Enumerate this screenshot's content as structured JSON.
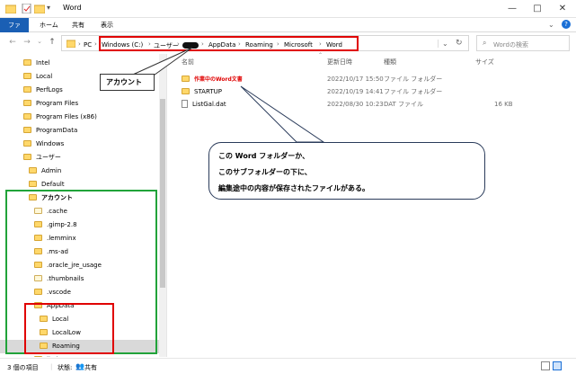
{
  "window": {
    "title": "Word",
    "minimize": "—",
    "maximize": "□",
    "close": "✕"
  },
  "ribbon": {
    "tabs": [
      "ファイル",
      "ホーム",
      "共有",
      "表示"
    ]
  },
  "address": {
    "crumbs": [
      "PC",
      "Windows (C:)",
      "ユーザー",
      "AppData",
      "Roaming",
      "Microsoft",
      "Word"
    ],
    "search_placeholder": "Wordの検索"
  },
  "nav_tree": [
    {
      "label": "Intel",
      "indent": 0
    },
    {
      "label": "Local",
      "indent": 0
    },
    {
      "label": "PerfLogs",
      "indent": 0
    },
    {
      "label": "Program Files",
      "indent": 0
    },
    {
      "label": "Program Files (x86)",
      "indent": 0
    },
    {
      "label": "ProgramData",
      "indent": 0
    },
    {
      "label": "Windows",
      "indent": 0
    },
    {
      "label": "ユーザー",
      "indent": 0
    },
    {
      "label": "Admin",
      "indent": 1
    },
    {
      "label": "Default",
      "indent": 1
    },
    {
      "label": "アカウント",
      "indent": 1
    },
    {
      "label": ".cache",
      "indent": 2
    },
    {
      "label": ".gimp-2.8",
      "indent": 2
    },
    {
      "label": ".lemminx",
      "indent": 2
    },
    {
      "label": ".ms-ad",
      "indent": 2
    },
    {
      "label": ".oracle_jre_usage",
      "indent": 2
    },
    {
      "label": ".thumbnails",
      "indent": 2
    },
    {
      "label": ".vscode",
      "indent": 2
    },
    {
      "label": "AppData",
      "indent": 2
    },
    {
      "label": "Local",
      "indent": 3
    },
    {
      "label": "LocalLow",
      "indent": 3
    },
    {
      "label": "Roaming",
      "indent": 3
    },
    {
      "label": "ibvi",
      "indent": 2
    }
  ],
  "file_list": {
    "headers": {
      "name": "名前",
      "date": "更新日時",
      "type": "種類",
      "size": "サイズ"
    },
    "rows": [
      {
        "name": "作業中のWord文書",
        "date": "2022/10/17 15:50",
        "type": "ファイル フォルダー",
        "size": ""
      },
      {
        "name": "STARTUP",
        "date": "2022/10/19 14:41",
        "type": "ファイル フォルダー",
        "size": ""
      },
      {
        "name": "ListGal.dat",
        "date": "2022/08/30 10:23",
        "type": "DAT ファイル",
        "size": "16 KB"
      }
    ]
  },
  "callouts": {
    "account": "アカウント",
    "main_lines": [
      "この Word フォルダーか、",
      "このサブフォルダーの下に、",
      "編集途中の内容が保存されたファイルがある。"
    ]
  },
  "status": {
    "count": "3 個の項目",
    "state_label": "状態:",
    "state_value": "共有"
  }
}
